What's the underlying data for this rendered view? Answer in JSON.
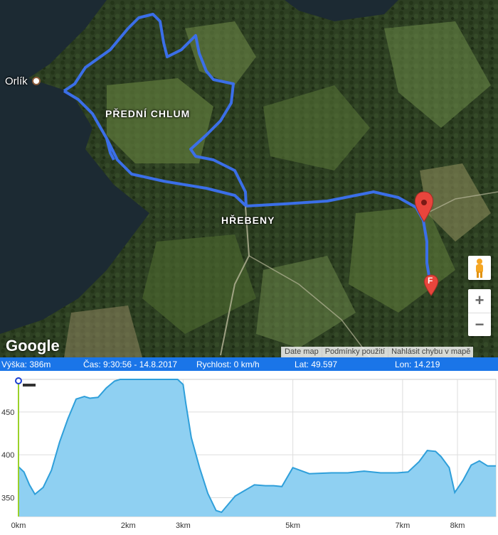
{
  "map": {
    "places": {
      "orlik": "Orlík",
      "predni_chlum": "PŘEDNÍ CHLUM",
      "hrebeny": "HŘEBENY"
    },
    "marker_label": "F",
    "google_logo": "Google",
    "zoom_in": "+",
    "zoom_out": "−",
    "attribution": [
      "Date map",
      "Podmínky použití",
      "Nahlásit chybu v mapě"
    ],
    "route_color": "#3b6fe8",
    "marker_color": "#e8453c"
  },
  "status": {
    "altitude": "Výška: 386m",
    "time": "Čas: 9:30:56 - 14.8.2017",
    "speed": "Rychlost: 0 km/h",
    "lat": "Lat: 49.597",
    "lon": "Lon: 14.219"
  },
  "chart_data": {
    "type": "area",
    "xlim": [
      0,
      8.7
    ],
    "ylim": [
      328,
      488
    ],
    "x_ticks": [
      0,
      2,
      3,
      5,
      7,
      8
    ],
    "x_tick_labels": [
      "0km",
      "2km",
      "3km",
      "5km",
      "7km",
      "8km"
    ],
    "y_ticks": [
      350,
      400,
      450
    ],
    "y_tick_labels": [
      "350",
      "400",
      "450"
    ],
    "grid": true,
    "fill_color": "#8fd0f2",
    "line_color": "#2f9fda",
    "x": [
      0,
      0.1,
      0.2,
      0.3,
      0.45,
      0.6,
      0.75,
      0.9,
      1.05,
      1.2,
      1.3,
      1.45,
      1.6,
      1.75,
      1.85,
      2.0,
      2.3,
      2.6,
      2.9,
      3.0,
      3.05,
      3.15,
      3.3,
      3.45,
      3.6,
      3.7,
      3.95,
      4.3,
      4.5,
      4.65,
      4.8,
      5.0,
      5.3,
      5.7,
      6.0,
      6.3,
      6.6,
      6.9,
      7.1,
      7.3,
      7.45,
      7.6,
      7.7,
      7.85,
      7.95,
      8.1,
      8.25,
      8.4,
      8.55,
      8.7
    ],
    "y": [
      386,
      380,
      365,
      354,
      362,
      382,
      415,
      442,
      465,
      468,
      466,
      467,
      478,
      486,
      488,
      488,
      488,
      488,
      488,
      482,
      460,
      420,
      385,
      355,
      335,
      333,
      352,
      365,
      364,
      364,
      363,
      385,
      378,
      379,
      379,
      381,
      379,
      379,
      380,
      392,
      405,
      404,
      398,
      385,
      356,
      370,
      388,
      393,
      387,
      387
    ],
    "marker_x": 0
  }
}
